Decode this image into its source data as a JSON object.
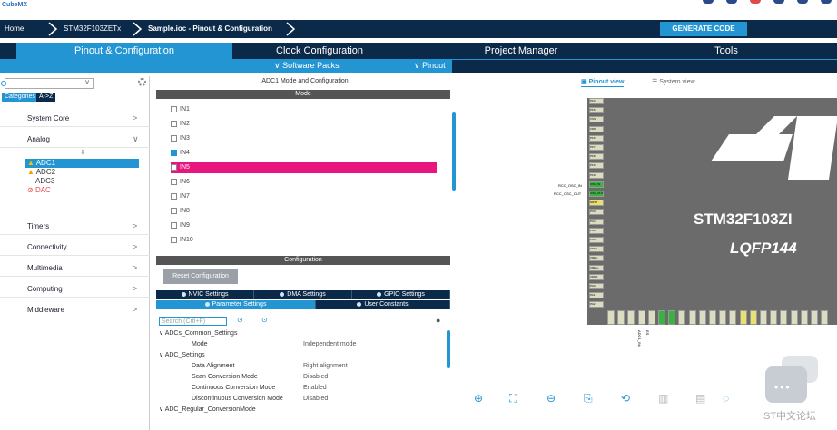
{
  "app": {
    "logo": "CubeMX"
  },
  "breadcrumb": {
    "home": "Home",
    "device": "STM32F103ZETx",
    "file": "Sample.ioc - Pinout & Configuration"
  },
  "toolbar": {
    "generate": "GENERATE CODE"
  },
  "tabs": [
    "Pinout & Configuration",
    "Clock Configuration",
    "Project Manager",
    "Tools"
  ],
  "subbar": {
    "software_packs": "∨ Software Packs",
    "pinout": "∨ Pinout"
  },
  "left": {
    "categories_btn": "Categories",
    "az_btn": "A->Z",
    "categories": [
      {
        "label": "System Core",
        "arrow": ">"
      },
      {
        "label": "Analog",
        "arrow": "∨"
      }
    ],
    "peripherals": [
      {
        "label": "ADC1",
        "warn": true,
        "selected": true
      },
      {
        "label": "ADC2",
        "warn": true
      },
      {
        "label": "ADC3"
      },
      {
        "label": "DAC",
        "disabled": true
      }
    ],
    "more_categories": [
      "Timers",
      "Connectivity",
      "Multimedia",
      "Computing",
      "Middleware"
    ]
  },
  "mid": {
    "title": "ADC1 Mode and Configuration",
    "mode_header": "Mode",
    "inputs": [
      {
        "label": "IN1"
      },
      {
        "label": "IN2"
      },
      {
        "label": "IN3"
      },
      {
        "label": "IN4",
        "checked": true
      },
      {
        "label": "IN5",
        "highlight": true
      },
      {
        "label": "IN6"
      },
      {
        "label": "IN7"
      },
      {
        "label": "IN8"
      },
      {
        "label": "IN9"
      },
      {
        "label": "IN10"
      }
    ],
    "config_header": "Configuration",
    "reset": "Reset Configuration",
    "settings_tabs": [
      "NVIC Settings",
      "DMA Settings",
      "GPIO Settings",
      "Parameter Settings",
      "User Constants"
    ],
    "search_placeholder": "Search (Crtl+F)",
    "params": [
      {
        "label": "ADCs_Common_Settings",
        "level": 0
      },
      {
        "label": "Mode",
        "value": "Independent mode",
        "level": 1
      },
      {
        "label": "ADC_Settings",
        "level": 0
      },
      {
        "label": "Data Alignment",
        "value": "Right alignment",
        "level": 1
      },
      {
        "label": "Scan Conversion Mode",
        "value": "Disabled",
        "level": 1
      },
      {
        "label": "Continuous Conversion Mode",
        "value": "Enabled",
        "level": 1
      },
      {
        "label": "Discontinuous Conversion Mode",
        "value": "Disabled",
        "level": 1
      },
      {
        "label": "ADC_Regular_ConversionMode",
        "level": 0
      }
    ]
  },
  "right": {
    "pinout_view": "Pinout view",
    "system_view": "System view",
    "chip_name": "STM32F103ZI",
    "chip_pkg": "LQFP144",
    "left_pins": [
      "PF4",
      "PF5",
      "VSS",
      "VDD",
      "PF6",
      "PF7",
      "PF8",
      "PF9",
      "PF10",
      "OSC_IN",
      "OSC_OUT",
      "NRST",
      "PC0",
      "PC1",
      "PC2",
      "PC3",
      "VSSA",
      "VREF-",
      "VREF+",
      "VDDA",
      "PA0-",
      "PA1",
      "PA2"
    ],
    "osc_in_label": "RCC_OSC_IN",
    "osc_out_label": "RCC_OSC_OUT",
    "bottom_pins": [
      "PA3",
      "VSS",
      "VDD",
      "PA4",
      "PA5",
      "PA6",
      "PA7",
      "PC4",
      "PC5",
      "PB0",
      "PB1",
      "PB2",
      "PF11",
      "PF12",
      "VSS",
      "VDD",
      "PF13",
      "PF14",
      "PF15",
      "PG0",
      "PG1",
      "PE7"
    ],
    "bottom_label1": "ADC1_IN4",
    "bottom_label2": "ES"
  },
  "watermark": "ST中文论坛"
}
